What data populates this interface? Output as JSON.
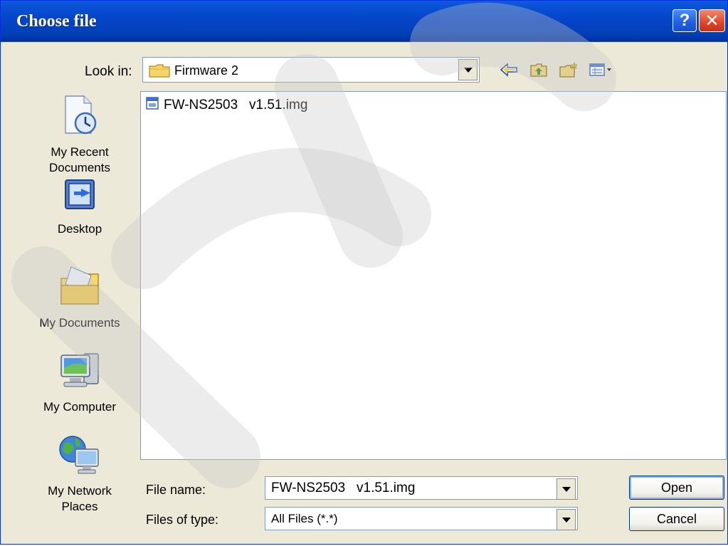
{
  "window": {
    "title": "Choose file",
    "help_glyph": "?",
    "close_glyph": "✕"
  },
  "lookin": {
    "label": "Look in:",
    "value": "Firmware 2",
    "icon": "folder-icon"
  },
  "toolbar": {
    "items": [
      "back-icon",
      "up-folder-icon",
      "new-folder-icon",
      "view-menu-icon"
    ]
  },
  "places": [
    {
      "label": "My Recent Documents",
      "line1": "My Recent",
      "line2": "Documents",
      "icon": "recent-documents-icon"
    },
    {
      "label": "Desktop",
      "line1": "Desktop",
      "line2": "",
      "icon": "desktop-icon"
    },
    {
      "label": "My Documents",
      "line1": "My Documents",
      "line2": "",
      "icon": "my-documents-icon"
    },
    {
      "label": "My Computer",
      "line1": "My Computer",
      "line2": "",
      "icon": "my-computer-icon"
    },
    {
      "label": "My Network Places",
      "line1": "My Network",
      "line2": "Places",
      "icon": "network-places-icon"
    }
  ],
  "files": [
    {
      "name": "FW-NS2503   v1.51.img",
      "icon": "image-file-icon"
    }
  ],
  "filename": {
    "label": "File name:",
    "value": "FW-NS2503   v1.51.img"
  },
  "filetype": {
    "label": "Files of type:",
    "value": "All Files (*.*)"
  },
  "buttons": {
    "open": "Open",
    "cancel": "Cancel"
  },
  "colors": {
    "titlebar": "#0444c8",
    "face": "#ece9d8",
    "close": "#e0452a"
  }
}
